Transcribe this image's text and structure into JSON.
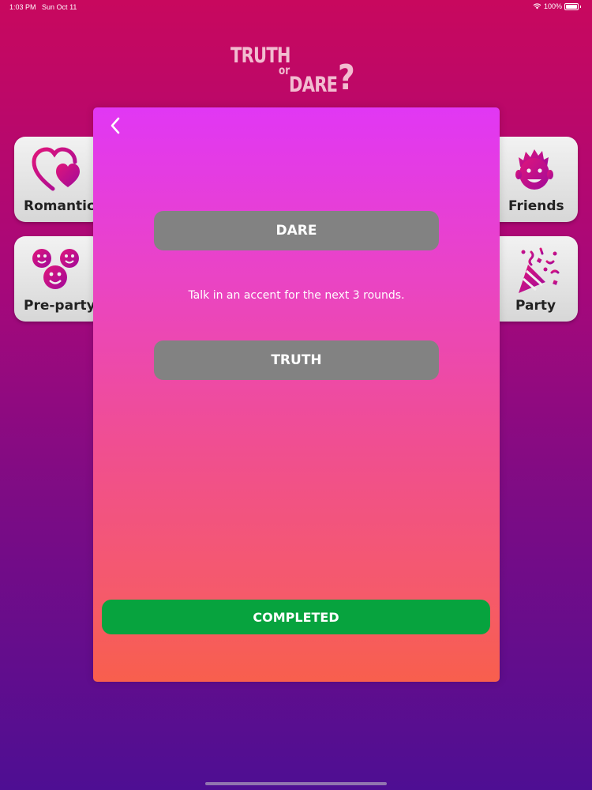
{
  "status_bar": {
    "time": "1:03 PM",
    "date": "Sun Oct 11",
    "battery_text": "100%"
  },
  "logo": {
    "truth": "TRUTH",
    "or": "or",
    "dare": "DARE",
    "question_mark": "?"
  },
  "categories": {
    "romantic": {
      "label": "Romantic",
      "icon": "hearts-icon"
    },
    "preparty": {
      "label": "Pre-party",
      "icon": "smiley-faces-icon"
    },
    "friends": {
      "label": "Friends",
      "icon": "friend-face-icon"
    },
    "party": {
      "label": "Party",
      "icon": "party-popper-icon"
    }
  },
  "modal": {
    "dare_label": "DARE",
    "prompt_text": "Talk in an accent for the next 3 rounds.",
    "truth_label": "TRUTH",
    "completed_label": "COMPLETED"
  },
  "colors": {
    "accent_pink": "#c8087a",
    "completed_green": "#07a33e",
    "pill_gray": "#828282"
  }
}
